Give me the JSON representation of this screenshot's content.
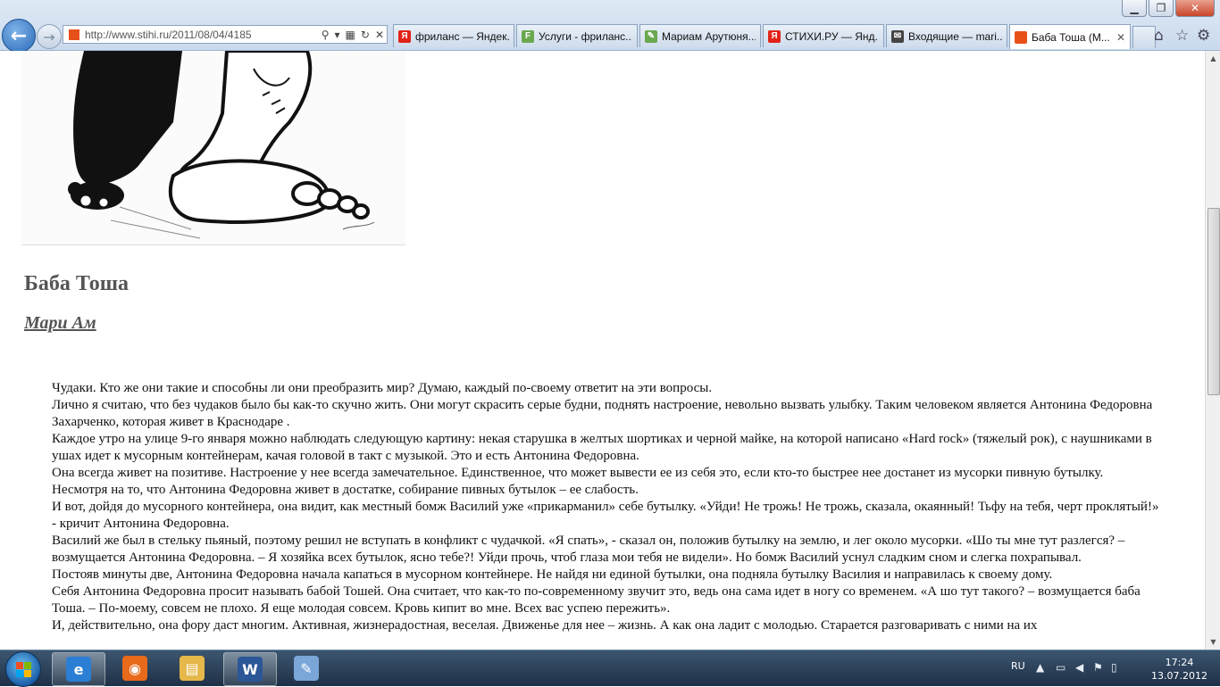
{
  "browser": {
    "url": "http://www.stihi.ru/2011/08/04/4185",
    "window_controls": {
      "minimize": "▁",
      "maximize": "❐",
      "close": "✕"
    },
    "tabs": [
      {
        "label": "фриланс — Яндек...",
        "icon_text": "Я",
        "icon_color": "#e2231a",
        "active": false
      },
      {
        "label": "Услуги - фриланс...",
        "icon_text": "F",
        "icon_color": "#6aa84f",
        "active": false
      },
      {
        "label": "Мариам Арутюня...",
        "icon_text": "✎",
        "icon_color": "#6aa84f",
        "active": false
      },
      {
        "label": "СТИХИ.РУ — Янд...",
        "icon_text": "Я",
        "icon_color": "#e2231a",
        "active": false
      },
      {
        "label": "Входящие — mari...",
        "icon_text": "✉",
        "icon_color": "#444444",
        "active": false
      },
      {
        "label": "Баба Тоша (М...",
        "icon_text": "",
        "icon_color": "#e8501a",
        "active": true
      }
    ]
  },
  "page": {
    "title": "Баба Тоша",
    "author": "Мари Ам",
    "paragraphs": [
      "Чудаки. Кто же они такие и способны ли они преобразить мир? Думаю, каждый по-своему ответит на эти вопросы.",
      "Лично я считаю, что без чудаков было бы как-то скучно жить. Они могут скрасить серые будни, поднять настроение, невольно вызвать улыбку. Таким человеком является Антонина Федоровна Захарченко, которая живет в Краснодаре .",
      "Каждое утро на улице 9-го января можно наблюдать следующую картину: некая старушка в желтых шортиках и черной майке, на которой написано «Hard rock» (тяжелый рок), с наушниками в ушах идет к мусорным контейнерам, качая головой в такт с музыкой. Это и есть Антонина Федоровна.",
      "Она всегда живет на позитиве. Настроение у нее всегда замечательное. Единственное, что может вывести ее из себя это, если кто-то быстрее нее достанет из мусорки пивную бутылку. Несмотря на то, что Антонина Федоровна живет в достатке, собирание пивных бутылок – ее слабость.",
      "И вот, дойдя до мусорного контейнера, она видит, как местный бомж Василий уже «прикарманил» себе бутылку. «Уйди! Не трожь! Не трожь, сказала, окаянный! Тьфу на тебя, черт проклятый!» - кричит Антонина Федоровна.",
      "Василий же был в стельку пьяный, поэтому решил не вступать в конфликт с чудачкой. «Я спать», - сказал он, положив бутылку на землю, и лег около мусорки. «Шо ты мне тут разлегся? – возмущается Антонина Федоровна. – Я хозяйка всех бутылок, ясно тебе?! Уйди прочь, чтоб глаза мои тебя не видели». Но бомж Василий уснул сладким сном и слегка похрапывал.",
      "Постояв минуты две, Антонина Федоровна начала капаться в мусорном контейнере. Не найдя ни единой бутылки, она подняла бутылку Василия и направилась к своему дому.",
      "Себя Антонина Федоровна просит называть бабой Тошей. Она считает, что как-то по-современному звучит это, ведь она сама идет в ногу со временем. «А шо тут такого? – возмущается баба Тоша. – По-моему, совсем не плохо. Я еще молодая совсем. Кровь кипит во мне. Всех вас успею пережить».",
      "И, действительно, она фору даст многим. Активная, жизнерадостная, веселая. Движенье для нее – жизнь. А как она ладит с молодью. Старается разговаривать с ними на их"
    ]
  },
  "taskbar": {
    "apps": [
      {
        "name": "ie",
        "icon_text": "e",
        "color": "#2a7fd4",
        "open": true
      },
      {
        "name": "firefox",
        "icon_text": "◉",
        "color": "#e86a1a",
        "open": false
      },
      {
        "name": "explorer",
        "icon_text": "▤",
        "color": "#e6b84a",
        "open": false
      },
      {
        "name": "word",
        "icon_text": "W",
        "color": "#2b5797",
        "open": true
      },
      {
        "name": "paint",
        "icon_text": "✎",
        "color": "#7aa6d8",
        "open": false
      }
    ],
    "lang": "RU",
    "time": "17:24",
    "date": "13.07.2012"
  }
}
